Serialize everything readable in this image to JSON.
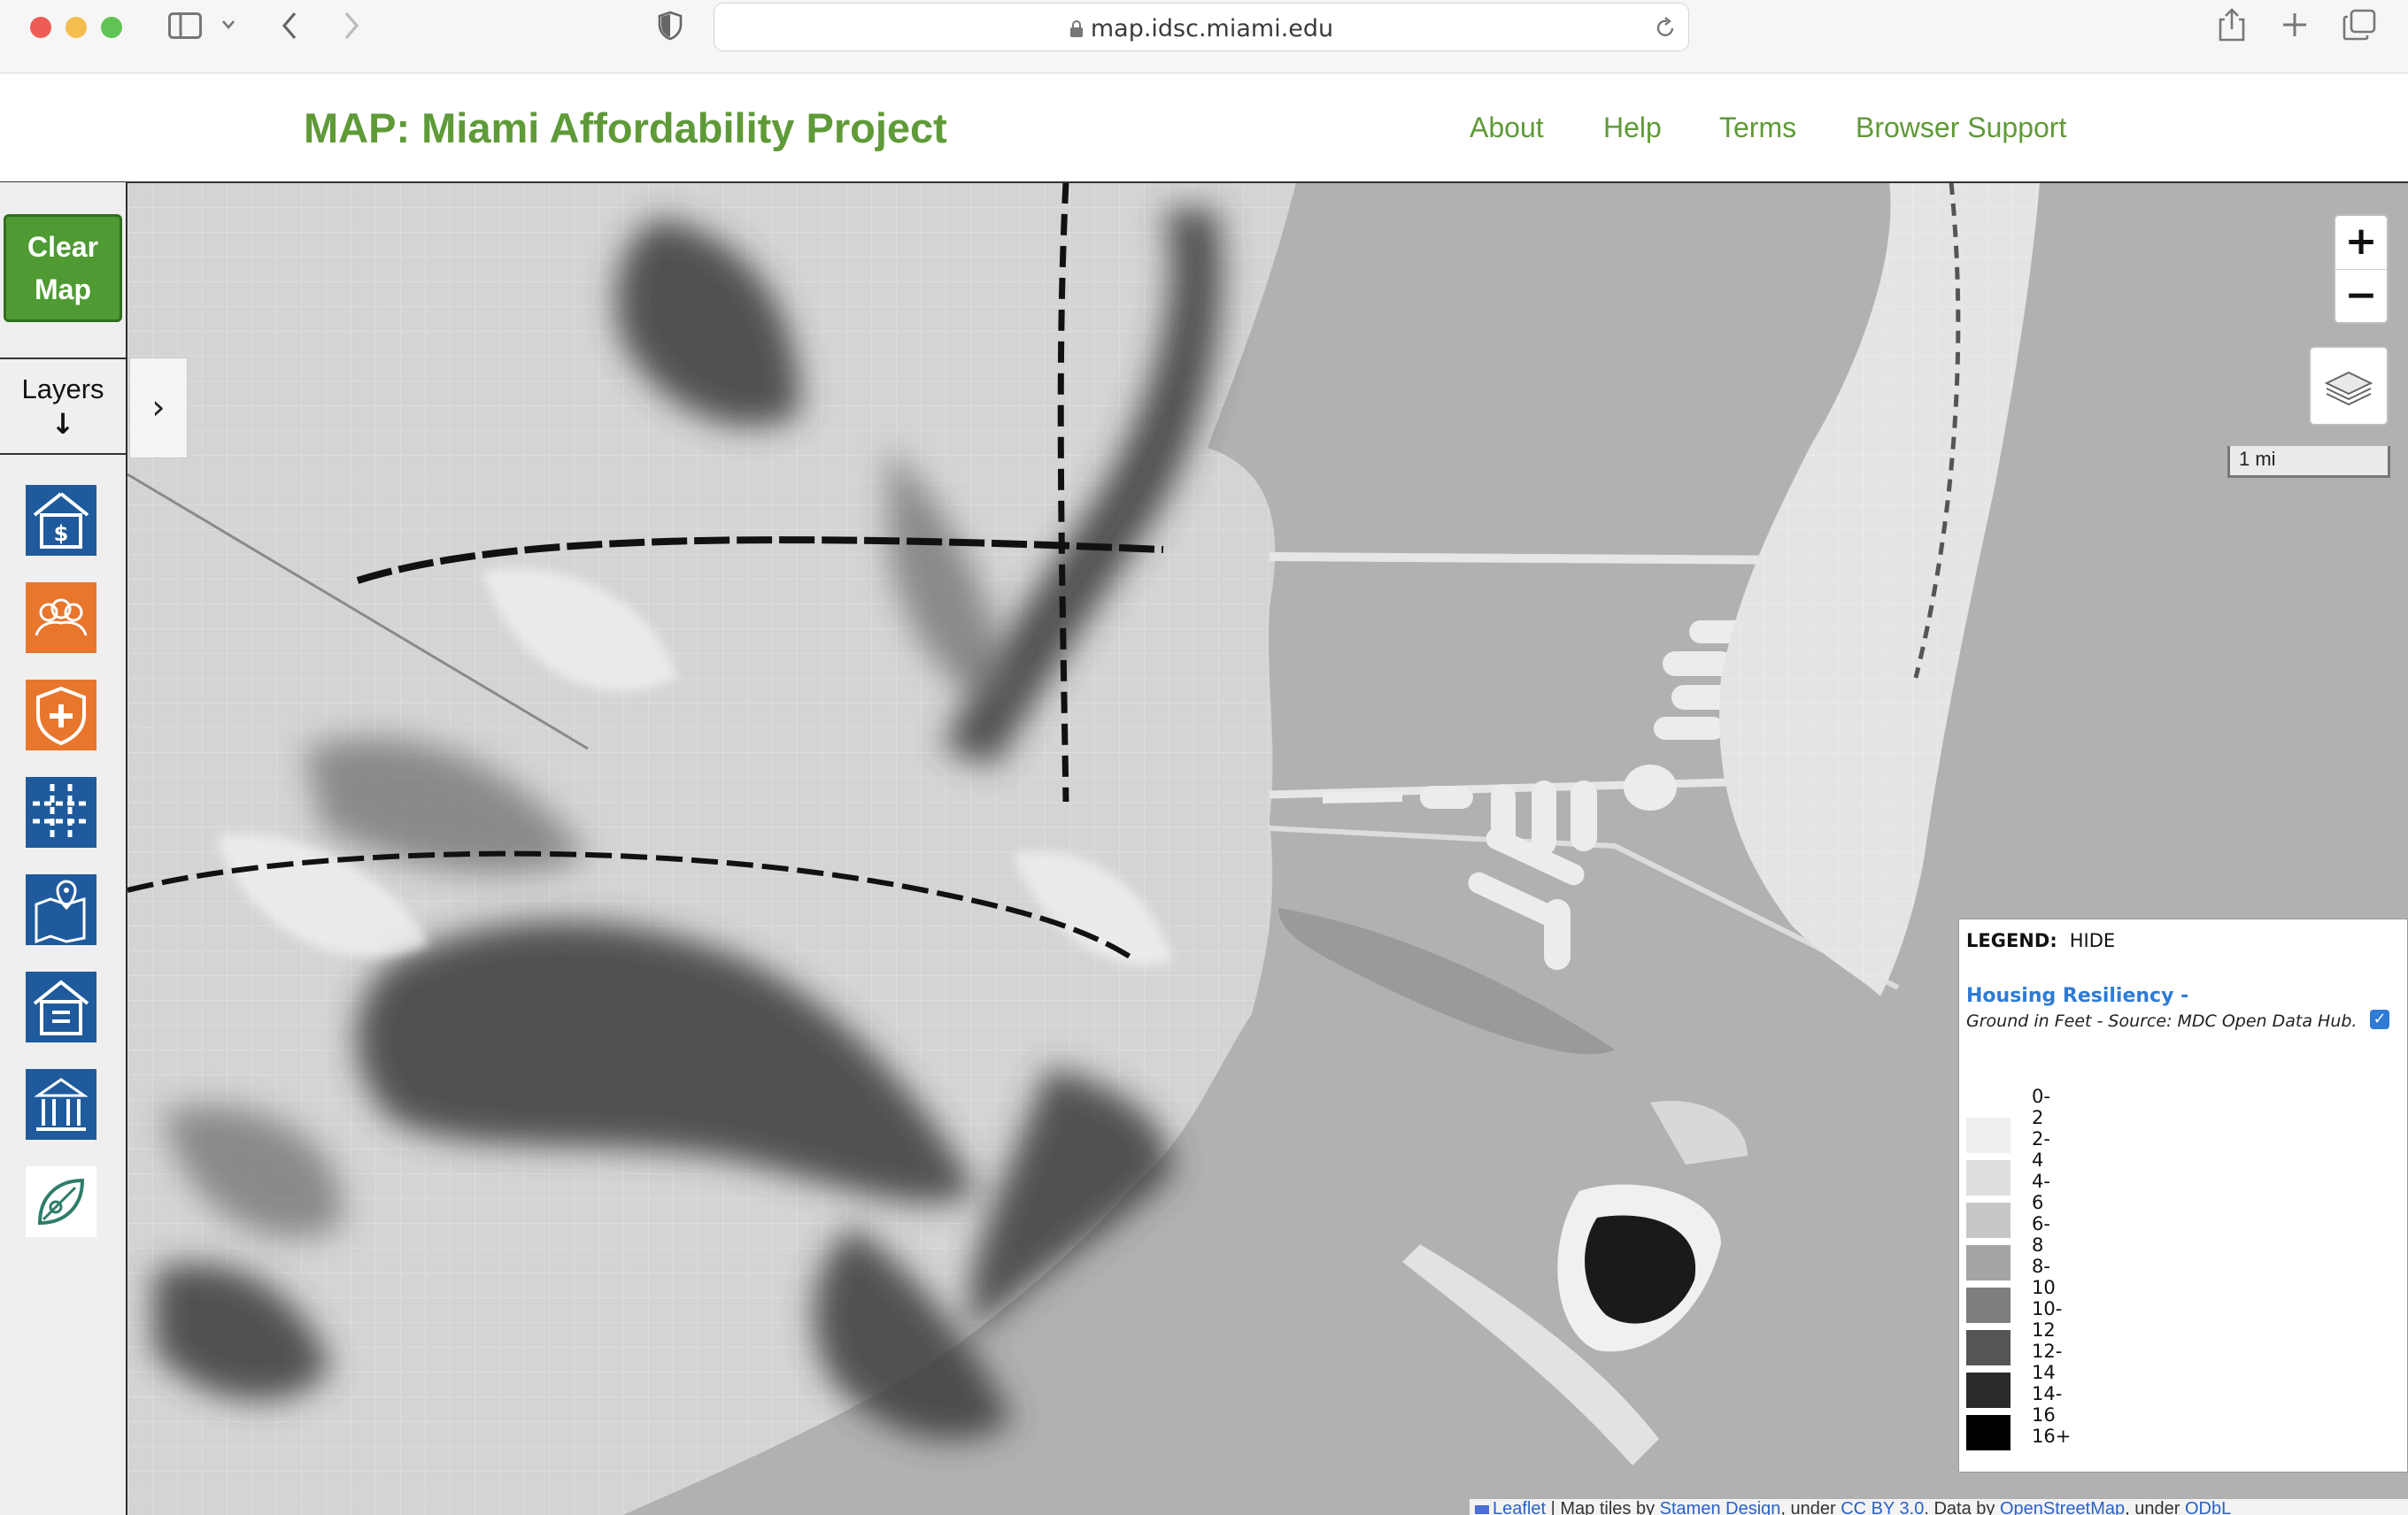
{
  "browser": {
    "url": "map.idsc.miami.edu"
  },
  "site": {
    "title": "MAP: Miami Affordability Project",
    "nav": [
      "About",
      "Help",
      "Terms",
      "Browser Support"
    ]
  },
  "sidebar": {
    "clear_map_label": "Clear Map",
    "layers_label": "Layers",
    "layer_icons": [
      {
        "icon": "house-dollar-icon",
        "color": "#1f5b9c"
      },
      {
        "icon": "people-group-icon",
        "color": "#e8762d"
      },
      {
        "icon": "health-shield-icon",
        "color": "#e8762d"
      },
      {
        "icon": "grid-transit-icon",
        "color": "#1f5b9c"
      },
      {
        "icon": "city-map-pin-icon",
        "color": "#1f5b9c"
      },
      {
        "icon": "public-housing-icon",
        "color": "#1f5b9c"
      },
      {
        "icon": "civic-building-icon",
        "color": "#1f5b9c"
      },
      {
        "icon": "environment-leaf-icon",
        "color": "#2e7d6a"
      }
    ]
  },
  "map": {
    "scale_label": "1 mi",
    "zoom_in": "+",
    "zoom_out": "−"
  },
  "legend": {
    "header": "LEGEND:",
    "toggle": "HIDE",
    "layer_title": "Housing Resiliency -",
    "layer_subtitle": "Ground in Feet - Source: MDC Open Data Hub.",
    "layer_checked": true,
    "items": [
      {
        "label": "0-2",
        "color": "#ffffff"
      },
      {
        "label": "2-4",
        "color": "#efefef"
      },
      {
        "label": "4-6",
        "color": "#dedede"
      },
      {
        "label": "6-8",
        "color": "#c6c6c6"
      },
      {
        "label": "8-10",
        "color": "#a4a4a4"
      },
      {
        "label": "10-12",
        "color": "#7e7e7e"
      },
      {
        "label": "12-14",
        "color": "#555555"
      },
      {
        "label": "14-16",
        "color": "#2a2a2a"
      },
      {
        "label": "16+",
        "color": "#000000"
      }
    ]
  },
  "attribution": {
    "leaflet": "Leaflet",
    "tiles_prefix": " | Map tiles by ",
    "stamen": "Stamen Design",
    "under1": ", under ",
    "ccby": "CC BY 3.0",
    "data_by": ". Data by ",
    "osm": "OpenStreetMap",
    "under2": ", under ",
    "odbl": "ODbL"
  }
}
